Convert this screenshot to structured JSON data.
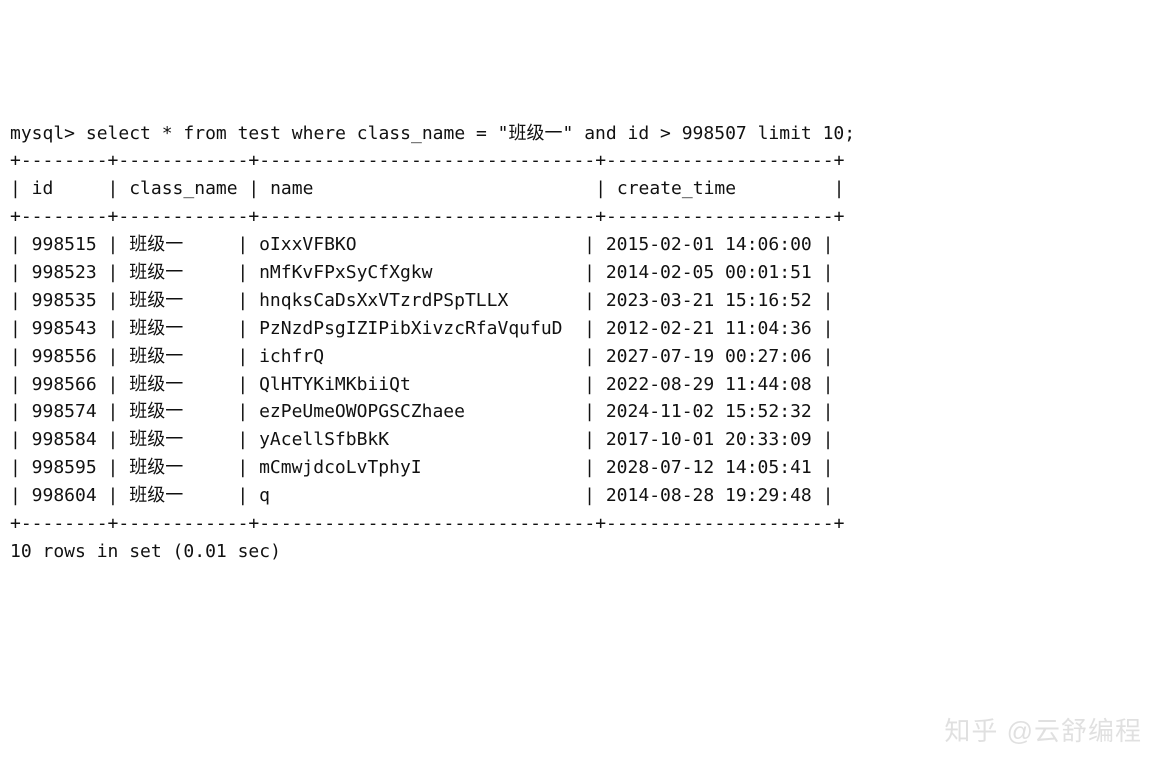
{
  "prompt": "mysql>",
  "query": "select * from test where class_name = \"班级一\" and id > 998507 limit 10;",
  "border_top": "+--------+------------+-------------------------------+---------------------+",
  "header_line": "| id     | class_name | name                          | create_time         |",
  "border_mid": "+--------+------------+-------------------------------+---------------------+",
  "rows": [
    "| 998515 | 班级一     | oIxxVFBKO                     | 2015-02-01 14:06:00 |",
    "| 998523 | 班级一     | nMfKvFPxSyCfXgkw              | 2014-02-05 00:01:51 |",
    "| 998535 | 班级一     | hnqksCaDsXxVTzrdPSpTLLX       | 2023-03-21 15:16:52 |",
    "| 998543 | 班级一     | PzNzdPsgIZIPibXivzcRfaVqufuD  | 2012-02-21 11:04:36 |",
    "| 998556 | 班级一     | ichfrQ                        | 2027-07-19 00:27:06 |",
    "| 998566 | 班级一     | QlHTYKiMKbiiQt                | 2022-08-29 11:44:08 |",
    "| 998574 | 班级一     | ezPeUmeOWOPGSCZhaee           | 2024-11-02 15:52:32 |",
    "| 998584 | 班级一     | yAcellSfbBkK                  | 2017-10-01 20:33:09 |",
    "| 998595 | 班级一     | mCmwjdcoLvTphyI               | 2028-07-12 14:05:41 |",
    "| 998604 | 班级一     | q                             | 2014-08-28 19:29:48 |"
  ],
  "border_bot": "+--------+------------+-------------------------------+---------------------+",
  "footer": "10 rows in set (0.01 sec)",
  "watermark": "知乎 @云舒编程",
  "chart_data": {
    "type": "table",
    "columns": [
      "id",
      "class_name",
      "name",
      "create_time"
    ],
    "data": [
      {
        "id": 998515,
        "class_name": "班级一",
        "name": "oIxxVFBKO",
        "create_time": "2015-02-01 14:06:00"
      },
      {
        "id": 998523,
        "class_name": "班级一",
        "name": "nMfKvFPxSyCfXgkw",
        "create_time": "2014-02-05 00:01:51"
      },
      {
        "id": 998535,
        "class_name": "班级一",
        "name": "hnqksCaDsXxVTzrdPSpTLLX",
        "create_time": "2023-03-21 15:16:52"
      },
      {
        "id": 998543,
        "class_name": "班级一",
        "name": "PzNzdPsgIZIPibXivzcRfaVqufuD",
        "create_time": "2012-02-21 11:04:36"
      },
      {
        "id": 998556,
        "class_name": "班级一",
        "name": "ichfrQ",
        "create_time": "2027-07-19 00:27:06"
      },
      {
        "id": 998566,
        "class_name": "班级一",
        "name": "QlHTYKiMKbiiQt",
        "create_time": "2022-08-29 11:44:08"
      },
      {
        "id": 998574,
        "class_name": "班级一",
        "name": "ezPeUmeOWOPGSCZhaee",
        "create_time": "2024-11-02 15:52:32"
      },
      {
        "id": 998584,
        "class_name": "班级一",
        "name": "yAcellSfbBkK",
        "create_time": "2017-10-01 20:33:09"
      },
      {
        "id": 998595,
        "class_name": "班级一",
        "name": "mCmwjdcoLvTphyI",
        "create_time": "2028-07-12 14:05:41"
      },
      {
        "id": 998604,
        "class_name": "班级一",
        "name": "q",
        "create_time": "2014-08-28 19:29:48"
      }
    ]
  }
}
